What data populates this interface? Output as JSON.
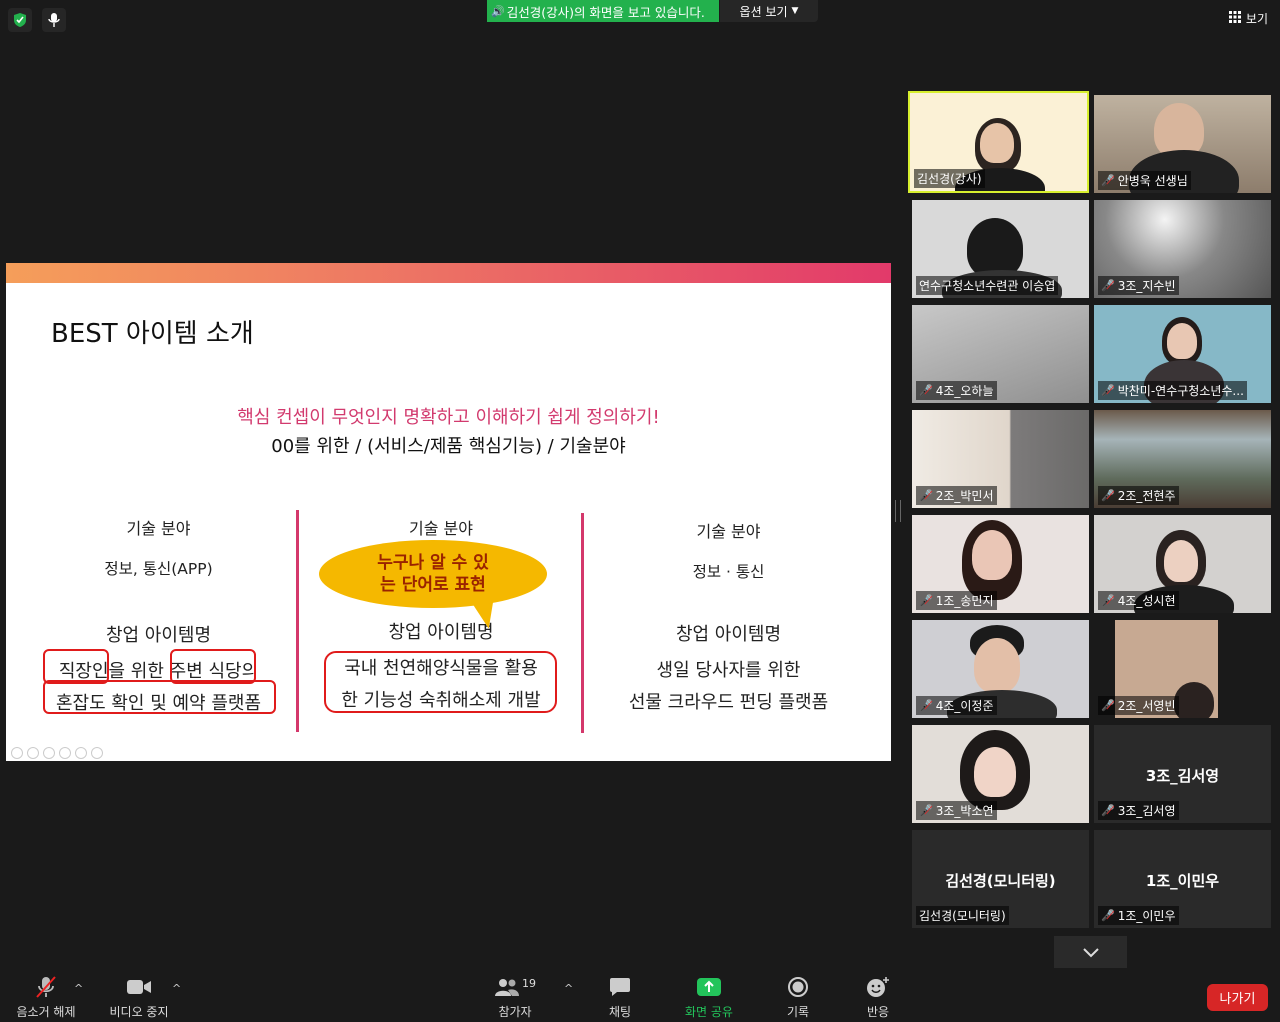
{
  "topbar": {
    "share_banner": "김선경(강사)의 화면을 보고 있습니다.",
    "options_label": "옵션 보기",
    "view_label": "보기"
  },
  "slide": {
    "title": "BEST 아이템 소개",
    "subtitle_accent": "핵심 컨셉이 무엇인지 명확하고 이해하기 쉽게 정의하기!",
    "subtitle_formula": "00를 위한 /  (서비스/제품 핵심기능) / 기술분야",
    "columns": [
      {
        "heading": "기술 분야",
        "field": "정보, 통신(APP)",
        "item_label": "창업 아이템명",
        "line1": "직장인을 위한 주변 식당의",
        "line2": "혼잡도 확인 및 예약 플랫폼"
      },
      {
        "heading": "기술 분야",
        "field": "",
        "item_label": "창업 아이템명",
        "line1": "국내 천연해양식물을 활용",
        "line2": "한 기능성 숙취해소제 개발"
      },
      {
        "heading": "기술 분야",
        "field": "정보 · 통신",
        "item_label": "창업 아이템명",
        "line1": "생일 당사자를 위한",
        "line2": "선물 크라우드 펀딩 플랫폼"
      }
    ],
    "bubble_line1": "누구나 알 수 있",
    "bubble_line2": "는 단어로 표현"
  },
  "participants": [
    {
      "name": "김선경(강사)",
      "muted": false,
      "active": true
    },
    {
      "name": "안병욱 선생님",
      "muted": true
    },
    {
      "name": "연수구청소년수련관 이승엽",
      "muted": false
    },
    {
      "name": "3조_지수빈",
      "muted": true
    },
    {
      "name": "4조_오하늘",
      "muted": true
    },
    {
      "name": "박찬미-연수구청소년수...",
      "muted": true
    },
    {
      "name": "2조_박민서",
      "muted": true
    },
    {
      "name": "2조_전현주",
      "muted": true
    },
    {
      "name": "1조_송민지",
      "muted": true
    },
    {
      "name": "4조_성시현",
      "muted": true
    },
    {
      "name": "4조_이정준",
      "muted": true
    },
    {
      "name": "2조_서영빈",
      "muted": true
    },
    {
      "name": "3조_박소연",
      "muted": true
    },
    {
      "name": "3조_김서영",
      "muted": true,
      "display": "3조_김서영"
    },
    {
      "name": "김선경(모니터링)",
      "muted": false,
      "display": "김선경(모니터링)"
    },
    {
      "name": "1조_이민우",
      "muted": true,
      "display": "1조_이민우"
    }
  ],
  "toolbar": {
    "unmute": "음소거 해제",
    "stop_video": "비디오 중지",
    "participants": "참가자",
    "participants_count": "19",
    "chat": "채팅",
    "share": "화면 공유",
    "record": "기록",
    "reactions": "반응",
    "leave": "나가기"
  },
  "colors": {
    "share_green": "#23b14d",
    "accent_pink": "#d4386b",
    "leave_red": "#d72626",
    "active_speaker": "#d7ef2e"
  }
}
